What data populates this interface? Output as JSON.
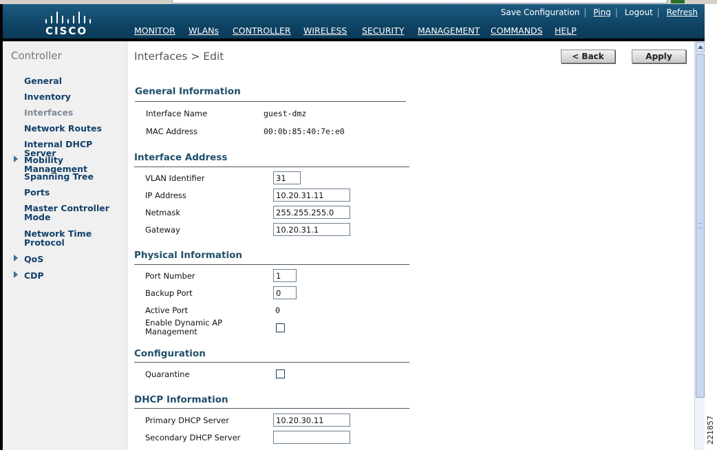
{
  "brand": {
    "logo_text": "CISCO"
  },
  "util_links": [
    "Save Configuration",
    "Ping",
    "Logout",
    "Refresh"
  ],
  "nav": [
    "MONITOR",
    "WLANs",
    "CONTROLLER",
    "WIRELESS",
    "SECURITY",
    "MANAGEMENT",
    "COMMANDS",
    "HELP"
  ],
  "nav_active": "CONTROLLER",
  "sidebar": {
    "title": "Controller",
    "items": [
      {
        "label": "General",
        "expandable": false
      },
      {
        "label": "Inventory",
        "expandable": false
      },
      {
        "label": "Interfaces",
        "expandable": false,
        "current": true
      },
      {
        "label": "Network Routes",
        "expandable": false
      },
      {
        "label": "Internal DHCP Server",
        "expandable": false
      },
      {
        "label": "Mobility Management",
        "expandable": true
      },
      {
        "label": "Spanning Tree",
        "expandable": false
      },
      {
        "label": "Ports",
        "expandable": false
      },
      {
        "label": "Master Controller Mode",
        "expandable": false
      },
      {
        "label": "Network Time Protocol",
        "expandable": false
      },
      {
        "label": "QoS",
        "expandable": true
      },
      {
        "label": "CDP",
        "expandable": true
      }
    ]
  },
  "page": {
    "title": "Interfaces > Edit",
    "back_label": "< Back",
    "apply_label": "Apply"
  },
  "sections": {
    "general": {
      "title": "General Information",
      "interface_name_label": "Interface Name",
      "interface_name": "guest-dmz",
      "mac_label": "MAC Address",
      "mac": "00:0b:85:40:7e:e0"
    },
    "address": {
      "title": "Interface Address",
      "vlan_label": "VLAN Identifier",
      "vlan": "31",
      "ip_label": "IP Address",
      "ip": "10.20.31.11",
      "netmask_label": "Netmask",
      "netmask": "255.255.255.0",
      "gateway_label": "Gateway",
      "gateway": "10.20.31.1"
    },
    "physical": {
      "title": "Physical Information",
      "port_label": "Port Number",
      "port": "1",
      "backup_label": "Backup Port",
      "backup": "0",
      "active_label": "Active Port",
      "active": "0",
      "dynamic_ap_label": "Enable Dynamic AP Management",
      "dynamic_ap_checked": false
    },
    "configuration": {
      "title": "Configuration",
      "quarantine_label": "Quarantine",
      "quarantine_checked": false
    },
    "dhcp": {
      "title": "DHCP Information",
      "primary_label": "Primary DHCP Server",
      "primary": "10.20.30.11",
      "secondary_label": "Secondary DHCP Server",
      "secondary": ""
    }
  },
  "figure_number": "221857"
}
